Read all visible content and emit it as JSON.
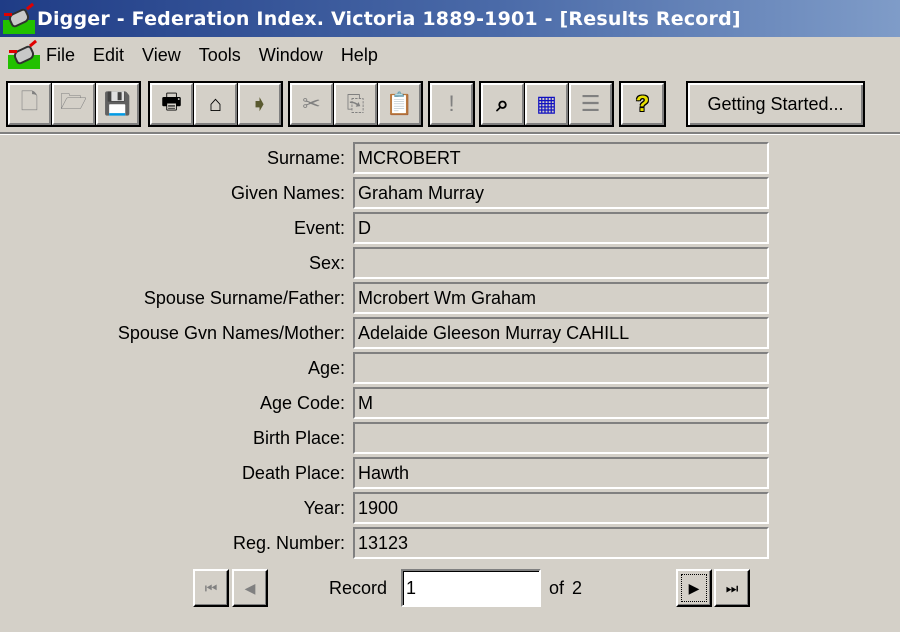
{
  "window": {
    "title": "Digger - Federation Index. Victoria 1889-1901 - [Results Record]",
    "accent_color": "#1f3c86"
  },
  "menu": {
    "items": [
      {
        "label": "File"
      },
      {
        "label": "Edit"
      },
      {
        "label": "View"
      },
      {
        "label": "Tools"
      },
      {
        "label": "Window"
      },
      {
        "label": "Help"
      }
    ]
  },
  "toolbar": {
    "buttons": [
      {
        "icon": "new-document-icon",
        "glyph": "🗋",
        "enabled": false
      },
      {
        "icon": "open-folder-icon",
        "glyph": "🗁",
        "enabled": false
      },
      {
        "icon": "save-disk-icon",
        "glyph": "💾",
        "enabled": false
      },
      {
        "icon": "print-icon",
        "glyph": "🖶",
        "enabled": true
      },
      {
        "icon": "print-setup-icon",
        "glyph": "⌂",
        "enabled": true
      },
      {
        "icon": "export-icon",
        "glyph": "➧",
        "enabled": true
      },
      {
        "icon": "cut-icon",
        "glyph": "✂",
        "enabled": false
      },
      {
        "icon": "copy-icon",
        "glyph": "⎘",
        "enabled": false
      },
      {
        "icon": "paste-icon",
        "glyph": "📋",
        "enabled": false
      },
      {
        "icon": "exclamation-icon",
        "glyph": "!",
        "enabled": false
      },
      {
        "icon": "binoculars-search-icon",
        "glyph": "⌕",
        "enabled": true
      },
      {
        "icon": "table-view-icon",
        "glyph": "▦",
        "enabled": true
      },
      {
        "icon": "record-view-icon",
        "glyph": "☰",
        "enabled": false
      },
      {
        "icon": "help-question-icon",
        "glyph": "?",
        "enabled": true
      }
    ],
    "getting_started_label": "Getting Started..."
  },
  "record": {
    "fields": [
      {
        "label": "Surname:",
        "value": "MCROBERT"
      },
      {
        "label": "Given Names:",
        "value": "Graham Murray"
      },
      {
        "label": "Event:",
        "value": "D"
      },
      {
        "label": "Sex:",
        "value": ""
      },
      {
        "label": "Spouse Surname/Father:",
        "value": "Mcrobert Wm Graham"
      },
      {
        "label": "Spouse Gvn Names/Mother:",
        "value": "Adelaide Gleeson Murray CAHILL"
      },
      {
        "label": "Age:",
        "value": ""
      },
      {
        "label": "Age Code:",
        "value": "M"
      },
      {
        "label": "Birth Place:",
        "value": ""
      },
      {
        "label": "Death Place:",
        "value": "Hawth"
      },
      {
        "label": "Year:",
        "value": "1900"
      },
      {
        "label": "Reg. Number:",
        "value": "13123"
      }
    ]
  },
  "navigation": {
    "record_label": "Record",
    "current_record": "1",
    "of_label": "of 2",
    "first_glyph": "⏮",
    "prev_glyph": "◀",
    "next_glyph": "▶",
    "last_glyph": "⏭"
  }
}
